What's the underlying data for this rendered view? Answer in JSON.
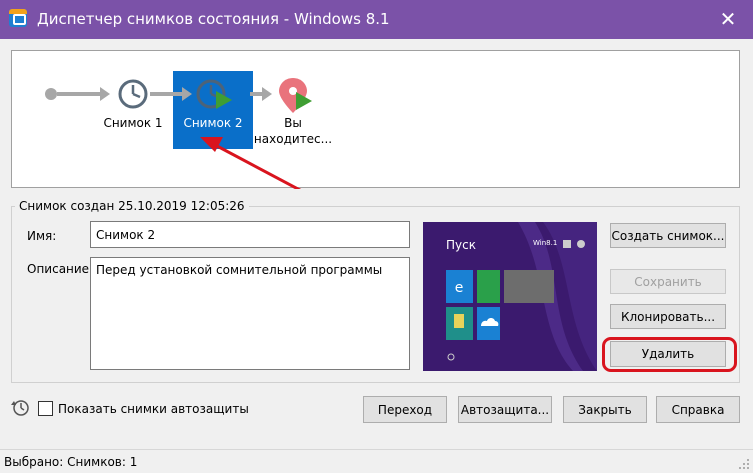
{
  "window": {
    "title": "Диспетчер снимков состояния - Windows 8.1",
    "close_glyph": "✕"
  },
  "timeline": {
    "nodes": [
      {
        "label": "Снимок 1",
        "icon": "clock-icon"
      },
      {
        "label": "Снимок 2",
        "icon": "clock-play-icon",
        "selected": true
      },
      {
        "label_line1": "Вы",
        "label_line2": "находитес...",
        "icon": "location-pin-icon"
      }
    ],
    "accent": "#0a6fc9",
    "annotation_color": "#d9141e"
  },
  "details": {
    "group_title": "Снимок создан 25.10.2019 12:05:26",
    "name_label": "Имя:",
    "name_value": "Снимок 2",
    "description_label": "Описание:",
    "description_value": "Перед установкой сомнительной программы"
  },
  "preview": {
    "start_label": "Пуск",
    "user_label": "Win8.1"
  },
  "side_buttons": {
    "create": "Создать снимок...",
    "save": "Сохранить",
    "clone": "Клонировать...",
    "delete": "Удалить"
  },
  "bottom": {
    "show_autoprotect_label": "Показать снимки автозащиты",
    "goto": "Переход",
    "autoprotect": "Автозащита...",
    "close": "Закрыть",
    "help": "Справка"
  },
  "status": {
    "text": "Выбрано: Снимков: 1"
  }
}
